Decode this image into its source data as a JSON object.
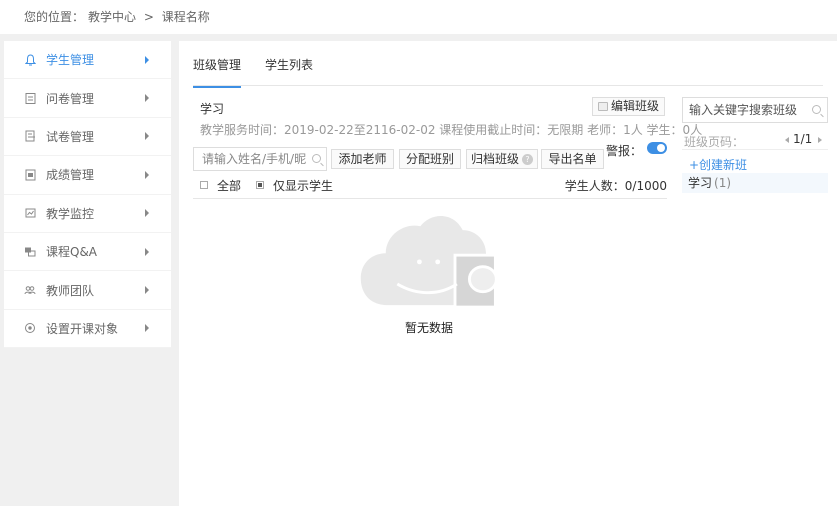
{
  "breadcrumb": {
    "prefix": "您的位置：",
    "items": [
      "教学中心",
      "课程名称"
    ],
    "separator": ">"
  },
  "sidebar": {
    "items": [
      {
        "label": "学生管理",
        "icon": "bell-icon",
        "active": true
      },
      {
        "label": "问卷管理",
        "icon": "clipboard-icon"
      },
      {
        "label": "试卷管理",
        "icon": "exam-icon"
      },
      {
        "label": "成绩管理",
        "icon": "grade-icon"
      },
      {
        "label": "教学监控",
        "icon": "monitor-icon"
      },
      {
        "label": "课程Q&A",
        "icon": "chat-icon"
      },
      {
        "label": "教师团队",
        "icon": "team-icon"
      },
      {
        "label": "设置开课对象",
        "icon": "target-icon"
      }
    ]
  },
  "tabs": [
    {
      "label": "班级管理",
      "active": true
    },
    {
      "label": "学生列表"
    }
  ],
  "class_panel": {
    "title": "学习",
    "edit_label": "编辑班级",
    "info": "教学服务时间：2019-02-22至2116-02-02 课程使用截止时间：无限期 老师：1人 学生：0人",
    "search_placeholder": "请输入姓名/手机/昵",
    "buttons": {
      "add_teacher": "添加老师",
      "assign_class": "分配班别",
      "archive_class": "归档班级",
      "export_list": "导出名单"
    },
    "warn_label": "警报：",
    "warn_on": true,
    "filter_all": "全部",
    "filter_students_only": "仅显示学生",
    "student_count": "学生人数：0/1000",
    "empty_text": "暂无数据"
  },
  "right_panel": {
    "search_placeholder": "输入关键字搜索班级",
    "pager_label": "班级页码：",
    "pager_value": "1/1",
    "create_label": "+创建新班",
    "classes": [
      {
        "name": "学习",
        "count": "(1)"
      }
    ]
  },
  "colors": {
    "accent": "#3d8fe4",
    "background": "#f0f0f0"
  }
}
